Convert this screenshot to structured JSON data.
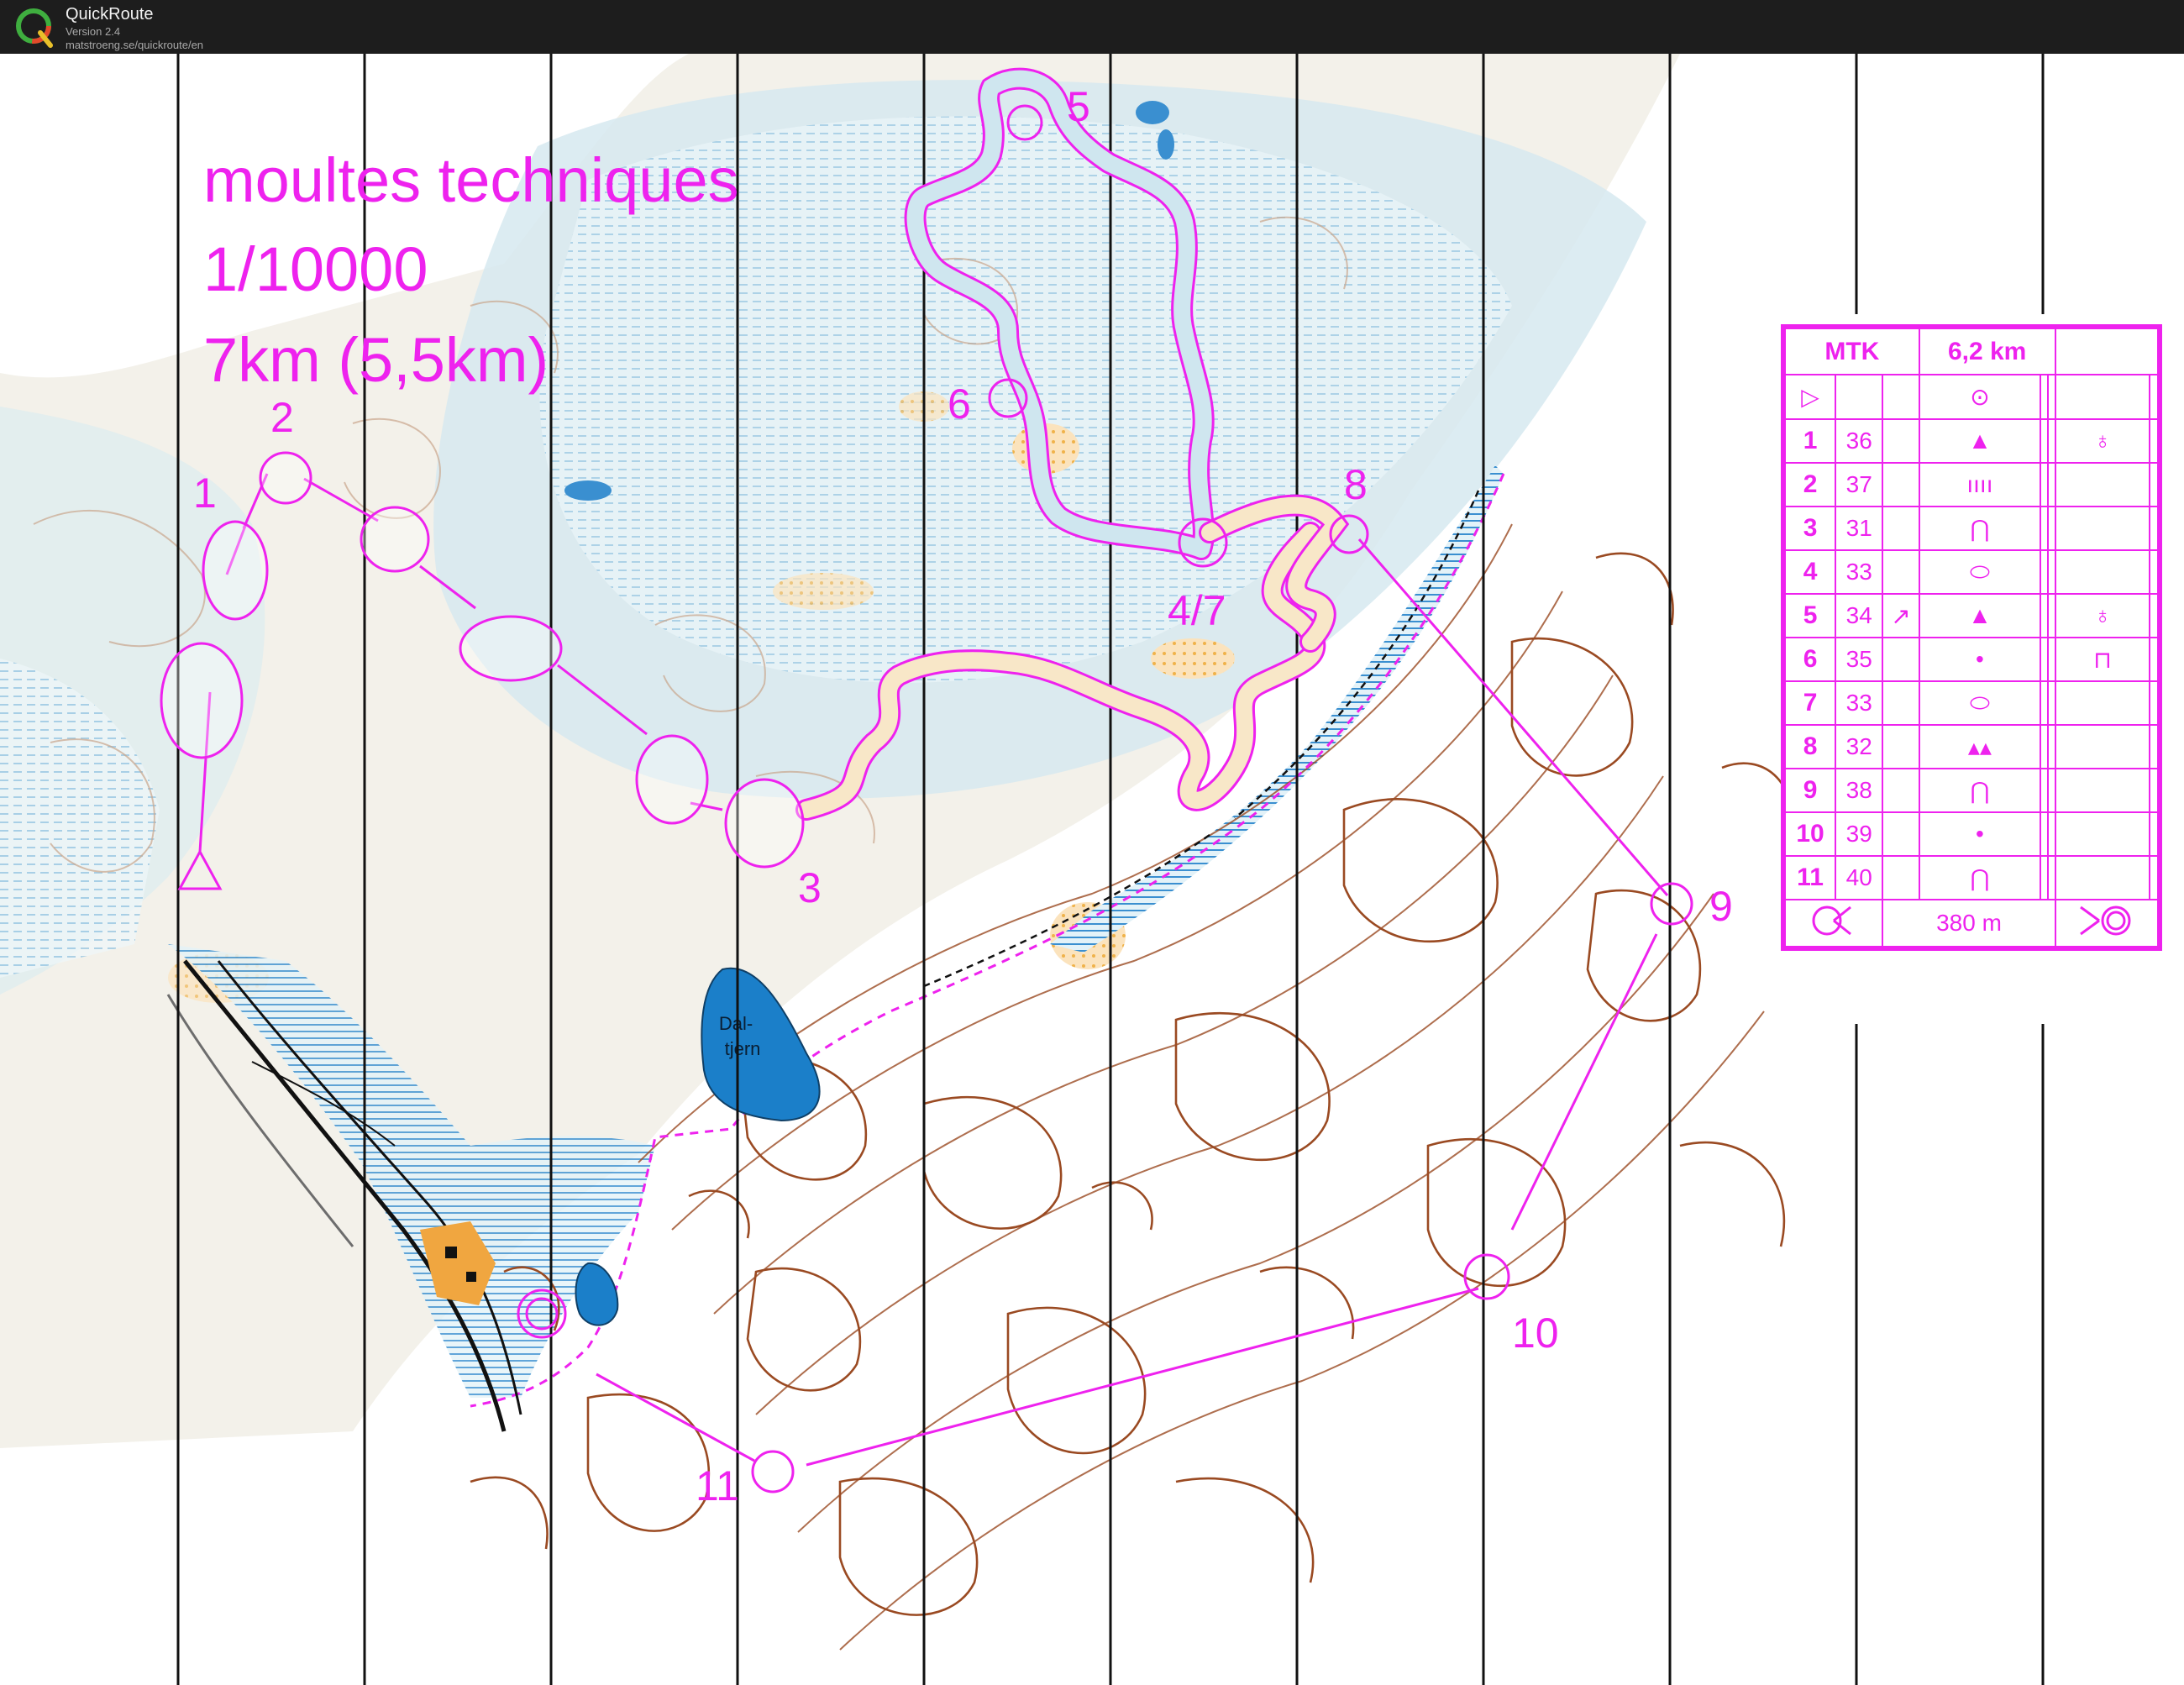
{
  "app": {
    "name": "QuickRoute",
    "version": "Version 2.4",
    "url": "matstroeng.se/quickroute/en"
  },
  "course": {
    "title": "moultes techniques",
    "scale": "1/10000",
    "length": "7km (5,5km)"
  },
  "map_labels": {
    "lake_name": [
      "Dal-",
      "tjern"
    ],
    "controls": [
      {
        "label": "1"
      },
      {
        "label": "2"
      },
      {
        "label": "3"
      },
      {
        "label": "4/7"
      },
      {
        "label": "5"
      },
      {
        "label": "6"
      },
      {
        "label": "8"
      },
      {
        "label": "9"
      },
      {
        "label": "10"
      },
      {
        "label": "11"
      }
    ]
  },
  "control_card": {
    "event": "MTK",
    "length": "6,2 km",
    "start_symbol": "▷",
    "start_feature_symbol": "⊙",
    "rows": [
      {
        "num": "1",
        "code": "36",
        "dir": "",
        "feature": "▲",
        "extra": "♁"
      },
      {
        "num": "2",
        "code": "37",
        "dir": "",
        "feature": "ıııı",
        "extra": ""
      },
      {
        "num": "3",
        "code": "31",
        "dir": "",
        "feature": "⋂",
        "extra": ""
      },
      {
        "num": "4",
        "code": "33",
        "dir": "",
        "feature": "⬭",
        "extra": ""
      },
      {
        "num": "5",
        "code": "34",
        "dir": "↗",
        "feature": "▲",
        "extra": "♁"
      },
      {
        "num": "6",
        "code": "35",
        "dir": "",
        "feature": "•",
        "extra": "⊓"
      },
      {
        "num": "7",
        "code": "33",
        "dir": "",
        "feature": "⬭",
        "extra": ""
      },
      {
        "num": "8",
        "code": "32",
        "dir": "",
        "feature": "▴▴",
        "extra": ""
      },
      {
        "num": "9",
        "code": "38",
        "dir": "",
        "feature": "⋂",
        "extra": ""
      },
      {
        "num": "10",
        "code": "39",
        "dir": "",
        "feature": "•",
        "extra": ""
      },
      {
        "num": "11",
        "code": "40",
        "dir": "",
        "feature": "⋂",
        "extra": ""
      }
    ],
    "finish_distance": "380 m"
  },
  "colors": {
    "course": "#ee22ee",
    "contour": "#9a4a22",
    "water": "#1b7fc9",
    "marsh": "#3a8fd0",
    "vegetation": "#cfe6ef",
    "yellow": "#f4c27a"
  }
}
